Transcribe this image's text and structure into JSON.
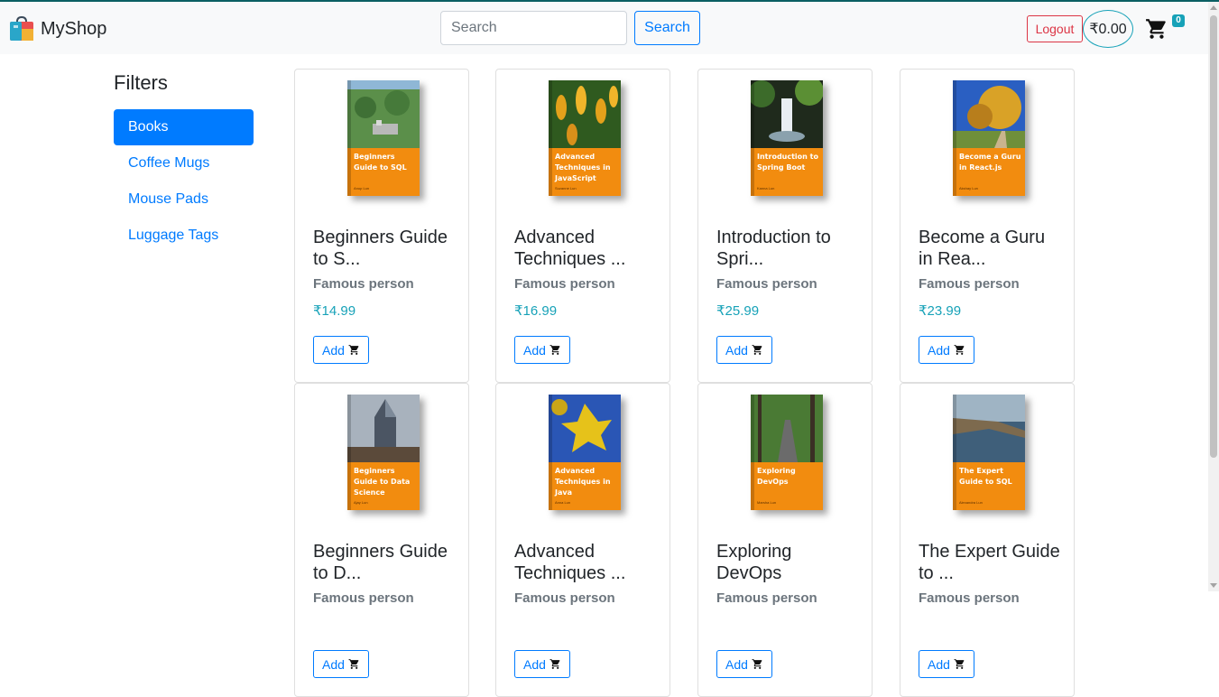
{
  "brand": {
    "name": "MyShop",
    "logo_icon": "shopping-bag-logo-icon"
  },
  "search": {
    "placeholder": "Search",
    "button_label": "Search"
  },
  "header": {
    "logout_label": "Logout",
    "total": "₹0.00",
    "cart_count": "0",
    "cart_icon": "cart-icon"
  },
  "filters": {
    "title": "Filters",
    "items": [
      {
        "label": "Books",
        "active": true
      },
      {
        "label": "Coffee Mugs",
        "active": false
      },
      {
        "label": "Mouse Pads",
        "active": false
      },
      {
        "label": "Luggage Tags",
        "active": false
      }
    ]
  },
  "products": [
    {
      "title": "Beginners Guide to S...",
      "author": "Famous person",
      "price": "₹14.99",
      "add_label": "Add",
      "cover_title": "Beginners Guide to SQL",
      "cover_author": "Anup Lun",
      "cover_scene": "city-aerial",
      "colors": [
        "#5b8f4a",
        "#8fb7d6"
      ]
    },
    {
      "title": "Advanced Techniques ...",
      "author": "Famous person",
      "price": "₹16.99",
      "add_label": "Add",
      "cover_title": "Advanced Techniques in JavaScript",
      "cover_author": "Suzanne Lun",
      "cover_scene": "yellow-flowers",
      "colors": [
        "#e3a11b",
        "#2f5a1f"
      ]
    },
    {
      "title": "Introduction to Spri...",
      "author": "Famous person",
      "price": "₹25.99",
      "add_label": "Add",
      "cover_title": "Introduction to Spring Boot",
      "cover_author": "Kanna Lun",
      "cover_scene": "waterfall",
      "colors": [
        "#3c6b2a",
        "#1f2a1c"
      ]
    },
    {
      "title": "Become a Guru in Rea...",
      "author": "Famous person",
      "price": "₹23.99",
      "add_label": "Add",
      "cover_title": "Become a Guru in React.js",
      "cover_author": "Akshay Lun",
      "cover_scene": "autumn-path",
      "colors": [
        "#d9a227",
        "#2a5fc2"
      ]
    },
    {
      "title": "Beginners Guide to D...",
      "author": "Famous person",
      "price": "",
      "add_label": "Add",
      "cover_title": "Beginners Guide to Data Science",
      "cover_author": "Ajay Lun",
      "cover_scene": "skyscraper",
      "colors": [
        "#a8b2bd",
        "#4b5563"
      ]
    },
    {
      "title": "Advanced Techniques ...",
      "author": "Famous person",
      "price": "",
      "add_label": "Add",
      "cover_title": "Advanced Techniques in Java",
      "cover_author": "Anna Lun",
      "cover_scene": "yellow-leaves",
      "colors": [
        "#e6c21a",
        "#2a56b5"
      ]
    },
    {
      "title": "Exploring DevOps",
      "author": "Famous person",
      "price": "",
      "add_label": "Add",
      "cover_title": "Exploring DevOps",
      "cover_author": "Marsha Lun",
      "cover_scene": "forest-trail",
      "colors": [
        "#4a7a34",
        "#6b6b6b"
      ]
    },
    {
      "title": "The Expert Guide to ...",
      "author": "Famous person",
      "price": "",
      "add_label": "Add",
      "cover_title": "The Expert Guide to SQL",
      "cover_author": "Alexandra Lun",
      "cover_scene": "coastline",
      "colors": [
        "#7d6a4e",
        "#3f5f7a"
      ]
    }
  ]
}
